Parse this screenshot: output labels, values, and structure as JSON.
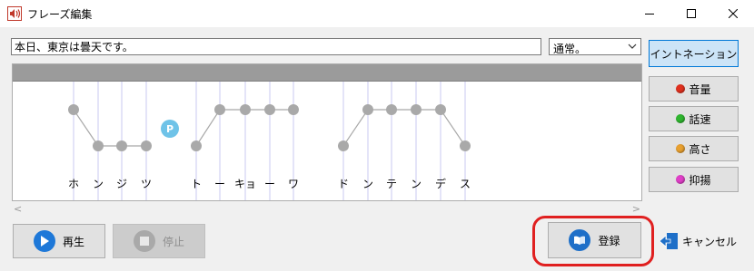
{
  "window": {
    "title": "フレーズ編集"
  },
  "phrase": {
    "text": "本日、東京は曇天です。"
  },
  "mode": {
    "selected": "通常。"
  },
  "editor": {
    "pause_label": "P",
    "kana": [
      "ホ",
      "ン",
      "ジ",
      "ツ",
      "ト",
      "ー",
      "キョ",
      "ー",
      "ワ",
      "ド",
      "ン",
      "テ",
      "ン",
      "デ",
      "ス"
    ],
    "pitch_levels": [
      "high",
      "low",
      "low",
      "low",
      "low",
      "high",
      "high",
      "high",
      "high",
      "low",
      "high",
      "high",
      "high",
      "high",
      "low"
    ]
  },
  "side_buttons": {
    "intonation": "イントネーション",
    "volume": "音量",
    "speed": "話速",
    "pitch": "高さ",
    "inflection": "抑揚"
  },
  "colors": {
    "volume": "#e0301e",
    "speed": "#2fb52f",
    "pitch": "#e8a030",
    "inflection": "#e040c8",
    "play_icon": "#1e78d8"
  },
  "bottom_buttons": {
    "play": "再生",
    "stop": "停止",
    "register": "登録",
    "cancel": "キャンセル"
  }
}
